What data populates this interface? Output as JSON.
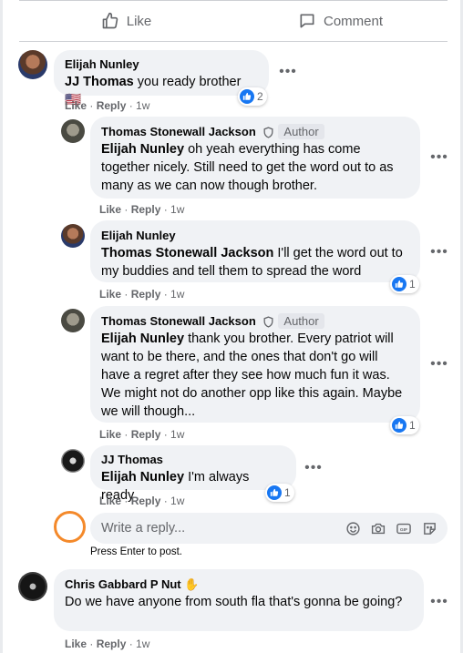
{
  "actions": {
    "like_label": "Like",
    "comment_label": "Comment"
  },
  "comments": [
    {
      "author": "Elijah Nunley",
      "mention": "JJ Thomas",
      "text": " you ready brother 🇺🇸",
      "like": "Like",
      "reply": "Reply",
      "time": "1w",
      "reactions": "2"
    },
    {
      "author": "Thomas Stonewall Jackson",
      "badge": "Author",
      "mention": "Elijah Nunley",
      "text": " oh yeah everything has come together nicely. Still need to get the word out to as many as we can now though brother.",
      "like": "Like",
      "reply": "Reply",
      "time": "1w"
    },
    {
      "author": "Elijah Nunley",
      "mention": "Thomas Stonewall Jackson",
      "text": " I'll get the word out to my buddies and tell them to spread the word",
      "like": "Like",
      "reply": "Reply",
      "time": "1w",
      "reactions": "1"
    },
    {
      "author": "Thomas Stonewall Jackson",
      "badge": "Author",
      "mention": "Elijah Nunley",
      "text": " thank you brother. Every patriot will want to be there, and the ones that don't go will have a regret after they see how much fun it was. We might not do another opp like this again. Maybe we will though...",
      "like": "Like",
      "reply": "Reply",
      "time": "1w",
      "reactions": "1"
    },
    {
      "author": "JJ Thomas",
      "mention": "Elijah Nunley",
      "text": " I'm always ready",
      "like": "Like",
      "reply": "Reply",
      "time": "1w",
      "reactions": "1"
    },
    {
      "author": "Chris Gabbard P Nut",
      "text": "Do we have anyone from south fla that's gonna be going?",
      "like": "Like",
      "reply": "Reply",
      "time": "1w"
    }
  ],
  "reply_box": {
    "placeholder": "Write a reply...",
    "hint": "Press Enter to post."
  },
  "colors": {
    "facebook_blue": "#1877f2",
    "bubble": "#f0f2f5",
    "secondary_text": "#65676b",
    "highlight_circle": "#f4892a"
  }
}
